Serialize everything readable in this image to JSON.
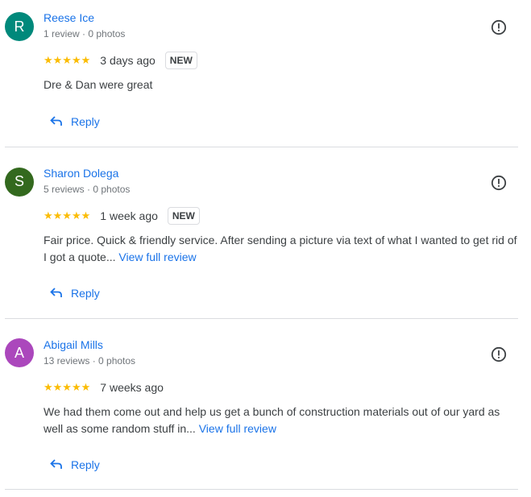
{
  "reviews": [
    {
      "initial": "R",
      "avatar_color": "#00897b",
      "name": "Reese Ice",
      "meta": "1 review · 0 photos",
      "stars": "★★★★★",
      "date": "3 days ago",
      "badge": "NEW",
      "text": "Dre & Dan were great",
      "more": "",
      "reply": "Reply"
    },
    {
      "initial": "S",
      "avatar_color": "#33691e",
      "name": "Sharon Dolega",
      "meta": "5 reviews · 0 photos",
      "stars": "★★★★★",
      "date": "1 week ago",
      "badge": "NEW",
      "text": "Fair price. Quick & friendly service. After sending a picture via text of what I wanted to get rid of I got a quote...",
      "more": "View full review",
      "reply": "Reply"
    },
    {
      "initial": "A",
      "avatar_color": "#ab47bc",
      "name": "Abigail Mills",
      "meta": "13 reviews · 0 photos",
      "stars": "★★★★★",
      "date": "7 weeks ago",
      "badge": "",
      "text": "We had them come out and help us get a bunch of construction materials out of our yard as well as some random stuff in...",
      "more": "View full review",
      "reply": "Reply"
    }
  ],
  "icons": {
    "flag": "report-flag-icon",
    "reply": "reply-arrow-icon"
  }
}
